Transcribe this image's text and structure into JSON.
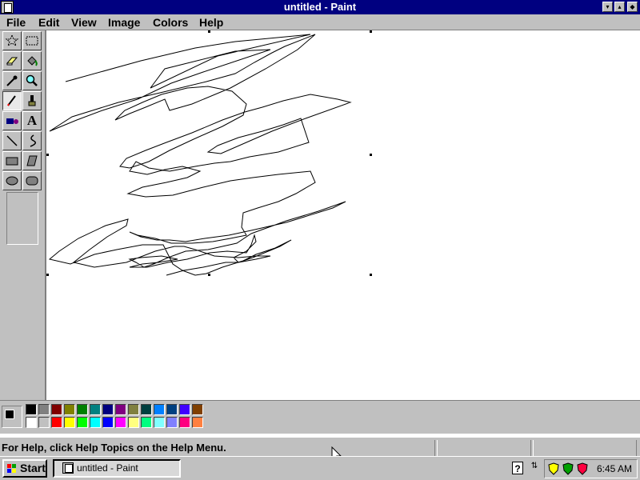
{
  "window": {
    "title": "untitled - Paint",
    "controls": {
      "minimize": "▾",
      "maximize": "▴",
      "close": "◆"
    }
  },
  "menubar": {
    "items": [
      "File",
      "Edit",
      "View",
      "Image",
      "Colors",
      "Help"
    ]
  },
  "toolbox": {
    "tools": [
      {
        "name": "free-form-select",
        "glyph": "☆"
      },
      {
        "name": "select",
        "glyph": "▭"
      },
      {
        "name": "eraser",
        "glyph": "▱"
      },
      {
        "name": "fill",
        "glyph": "◆"
      },
      {
        "name": "pick-color",
        "glyph": "✎"
      },
      {
        "name": "magnifier",
        "glyph": "⚲"
      },
      {
        "name": "pencil",
        "glyph": "✏"
      },
      {
        "name": "brush",
        "glyph": "♜"
      },
      {
        "name": "airbrush",
        "glyph": "✱"
      },
      {
        "name": "text",
        "glyph": "A"
      },
      {
        "name": "line",
        "glyph": "╲"
      },
      {
        "name": "curve",
        "glyph": "∫"
      },
      {
        "name": "rectangle",
        "glyph": "▬"
      },
      {
        "name": "polygon",
        "glyph": "▰"
      },
      {
        "name": "ellipse",
        "glyph": "⬭"
      },
      {
        "name": "rounded-rectangle",
        "glyph": "▢"
      }
    ],
    "active_tool": "pencil"
  },
  "palette": {
    "foreground": "#000000",
    "background": "#ffffff",
    "row1": [
      "#000000",
      "#808080",
      "#800000",
      "#808000",
      "#008000",
      "#008080",
      "#000080",
      "#800080",
      "#808040",
      "#004040",
      "#0080ff",
      "#004080",
      "#4000ff",
      "#804000"
    ],
    "row2": [
      "#ffffff",
      "#c0c0c0",
      "#ff0000",
      "#ffff00",
      "#00ff00",
      "#00ffff",
      "#0000ff",
      "#ff00ff",
      "#ffff80",
      "#00ff80",
      "#80ffff",
      "#8080ff",
      "#ff0080",
      "#ff8040"
    ]
  },
  "statusbar": {
    "help_text": "For Help, click Help Topics on the Help Menu."
  },
  "taskbar": {
    "start_label": "Start",
    "task_label": "untitled - Paint",
    "clock": "6:45 AM"
  }
}
